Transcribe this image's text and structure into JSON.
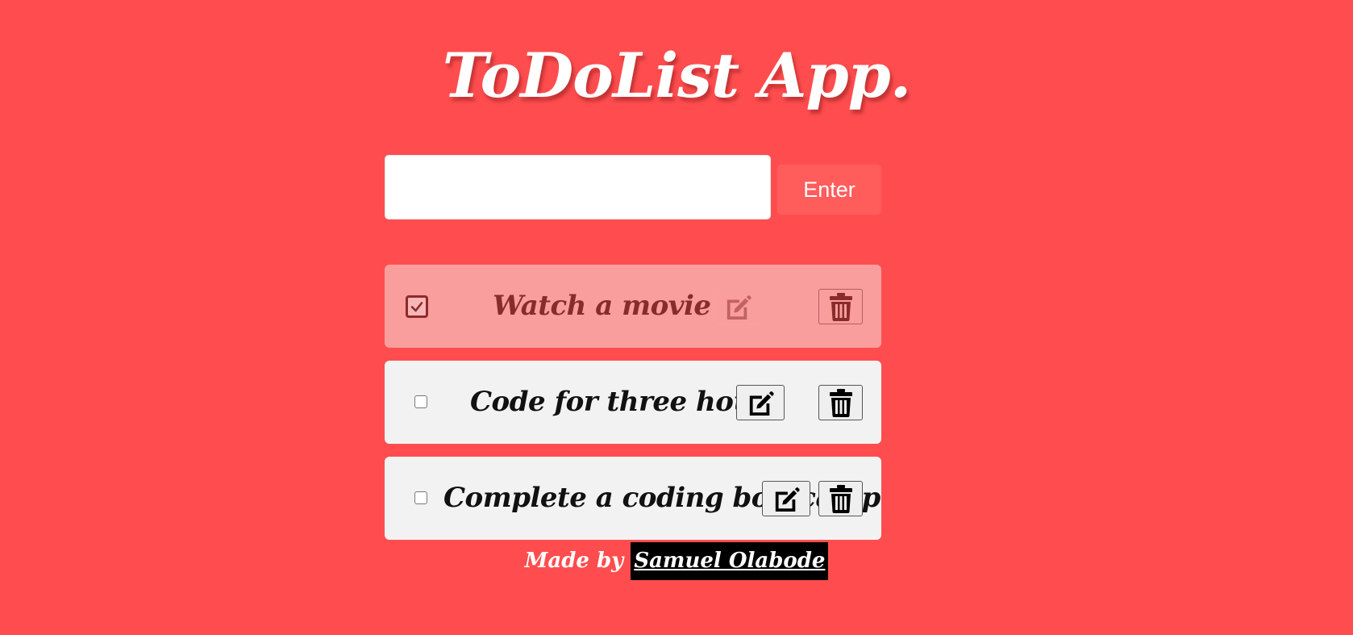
{
  "app": {
    "title": "ToDoList App."
  },
  "input": {
    "value": "",
    "placeholder": "",
    "enter_label": "Enter"
  },
  "todos": [
    {
      "text": "Watch a movie",
      "completed": true
    },
    {
      "text": "Code for three hours",
      "completed": false
    },
    {
      "text": "Complete a coding bootcamp",
      "completed": false
    }
  ],
  "footer": {
    "prefix": "Made by",
    "author": "Samuel Olabode"
  },
  "icons": {
    "edit": "edit-square-pen-icon",
    "delete": "trash-icon",
    "check": "checkmark-icon"
  },
  "colors": {
    "background": "#ff4d4f",
    "enter_button": "#ff5c5c",
    "completed_item": "#f99d9d",
    "item": "#f2f2f2",
    "completed_text": "#8a2b2b"
  }
}
